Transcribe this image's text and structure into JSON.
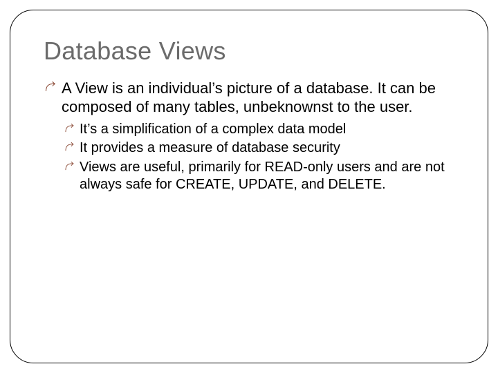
{
  "title": "Database Views",
  "bullets_lvl1": [
    "A View is an individual’s picture of a database.  It can be composed of many tables, unbeknownst to the user."
  ],
  "bullets_lvl2": [
    "It’s a simplification of a complex data model",
    "It provides a measure of database security",
    "Views are useful, primarily for READ-only users and are not always safe for CREATE, UPDATE, and DELETE."
  ]
}
